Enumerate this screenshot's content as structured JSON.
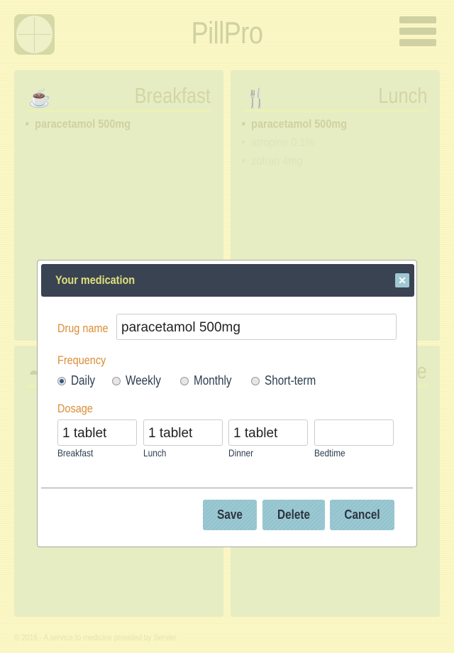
{
  "app": {
    "title": "PillPro"
  },
  "panels": {
    "breakfast": {
      "title": "Breakfast",
      "icon": "coffee-cup-icon",
      "items": [
        "paracetamol 500mg"
      ]
    },
    "lunch": {
      "title": "Lunch",
      "icon": "fork-knife-icon",
      "items": [
        "paracetamol 500mg",
        "atropine 0.1%",
        "zofran 4mg"
      ]
    },
    "dinner": {
      "icon": "cloche-icon"
    },
    "bedtime": {
      "title": "Bedtime"
    }
  },
  "footer": "© 2016 - A service to medicine provided by Servier",
  "modal": {
    "title": "Your medication",
    "drug_label": "Drug name",
    "drug_value": "paracetamol 500mg",
    "frequency_label": "Frequency",
    "frequency_options": [
      "Daily",
      "Weekly",
      "Monthly",
      "Short-term"
    ],
    "frequency_selected": "Daily",
    "dosage_label": "Dosage",
    "dosage": [
      {
        "label": "Breakfast",
        "value": "1 tablet"
      },
      {
        "label": "Lunch",
        "value": "1 tablet"
      },
      {
        "label": "Dinner",
        "value": "1 tablet"
      },
      {
        "label": "Bedtime",
        "value": ""
      }
    ],
    "buttons": {
      "save": "Save",
      "delete": "Delete",
      "cancel": "Cancel"
    }
  },
  "colors": {
    "header": "#3a4352",
    "accent_label": "#da8d36",
    "button": "#9ccad4",
    "title_yellow": "#dfe07a"
  }
}
